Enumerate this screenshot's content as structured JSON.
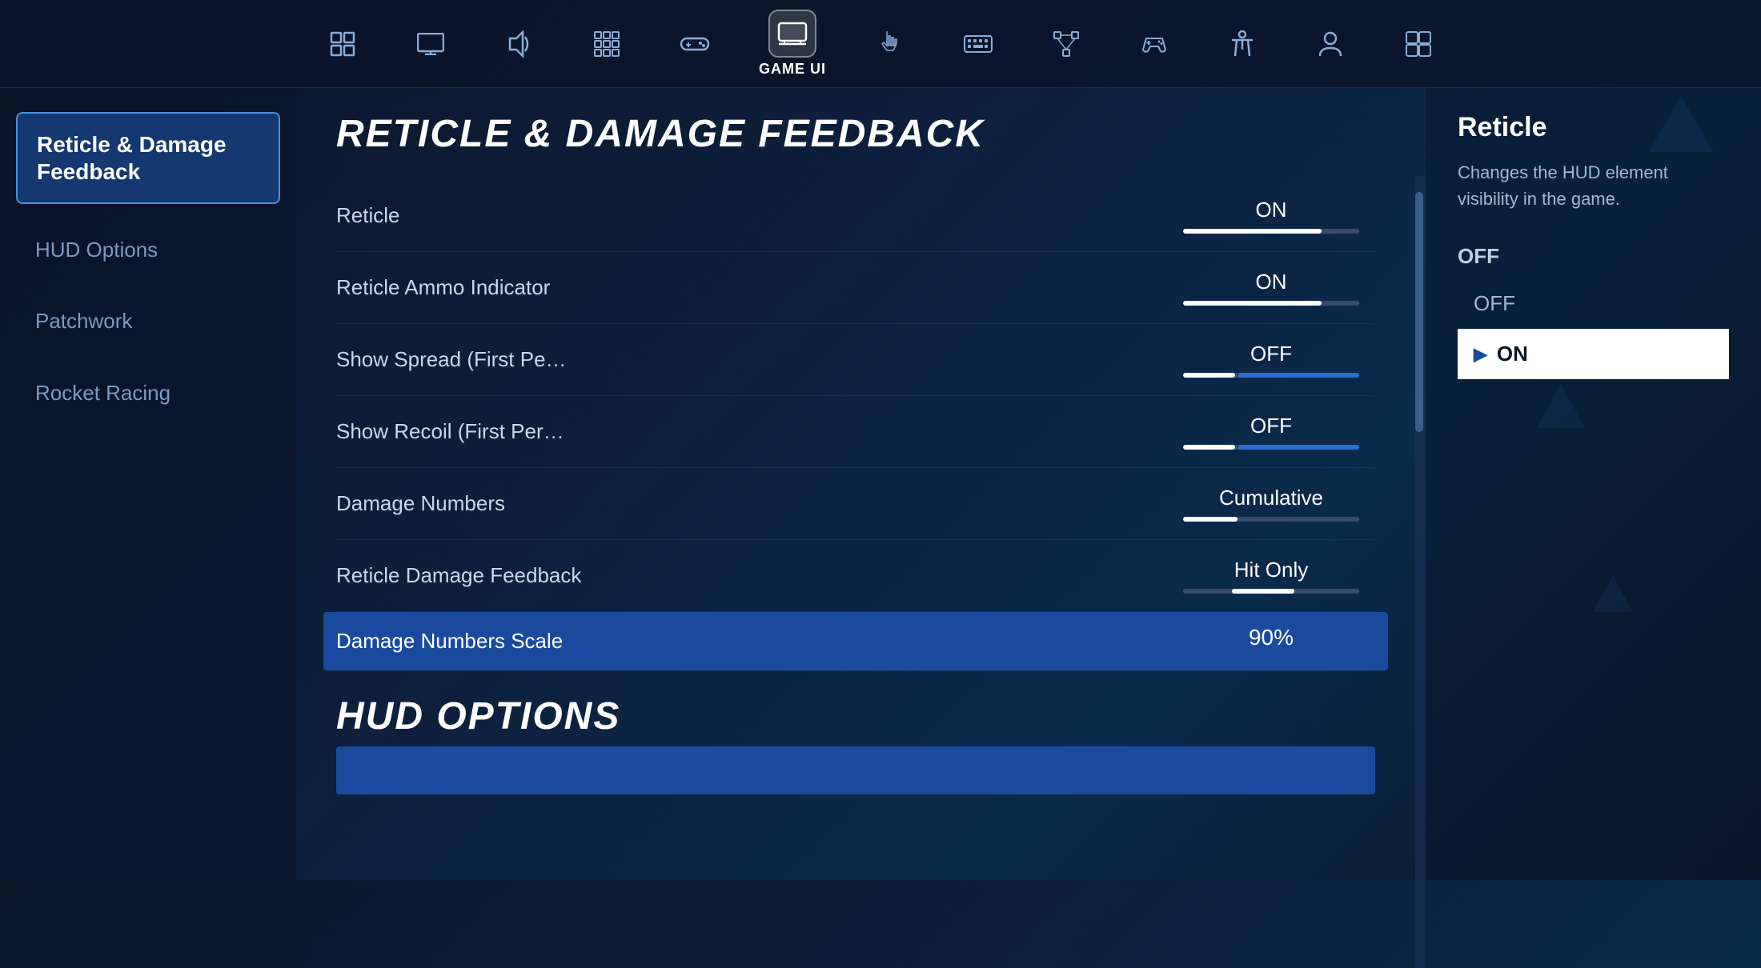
{
  "topNav": {
    "items": [
      {
        "id": "hud",
        "icon": "⬛",
        "label": "",
        "active": false
      },
      {
        "id": "display",
        "icon": "🖥",
        "label": "",
        "active": false
      },
      {
        "id": "audio",
        "icon": "🔊",
        "label": "",
        "active": false
      },
      {
        "id": "controller-layout",
        "icon": "⊞",
        "label": "",
        "active": false
      },
      {
        "id": "controller",
        "icon": "🎮",
        "label": "",
        "active": false
      },
      {
        "id": "game-ui",
        "icon": "🗖",
        "label": "GAME UI",
        "active": true
      },
      {
        "id": "touch",
        "icon": "✋",
        "label": "",
        "active": false
      },
      {
        "id": "keyboard",
        "icon": "⌨",
        "label": "",
        "active": false
      },
      {
        "id": "network",
        "icon": "⧫",
        "label": "",
        "active": false
      },
      {
        "id": "controller2",
        "icon": "🕹",
        "label": "",
        "active": false
      },
      {
        "id": "cross",
        "icon": "✦",
        "label": "",
        "active": false
      },
      {
        "id": "profile",
        "icon": "👤",
        "label": "",
        "active": false
      },
      {
        "id": "menu",
        "icon": "⬡",
        "label": "",
        "active": false
      }
    ]
  },
  "sidebar": {
    "items": [
      {
        "id": "reticle-damage",
        "label": "Reticle & Damage\nFeedback",
        "active": true
      },
      {
        "id": "hud-options",
        "label": "HUD Options",
        "active": false
      },
      {
        "id": "patchwork",
        "label": "Patchwork",
        "active": false
      },
      {
        "id": "rocket-racing",
        "label": "Rocket Racing",
        "active": false
      }
    ]
  },
  "mainContent": {
    "sectionTitle": "RETICLE & DAMAGE FEEDBACK",
    "settings": [
      {
        "id": "reticle",
        "name": "Reticle",
        "value": "ON",
        "sliderType": "on",
        "fillPercent": 80
      },
      {
        "id": "reticle-ammo",
        "name": "Reticle Ammo Indicator",
        "value": "ON",
        "sliderType": "on",
        "fillPercent": 80
      },
      {
        "id": "show-spread",
        "name": "Show Spread (First Pe…",
        "value": "OFF",
        "sliderType": "off",
        "fillPercent": 30
      },
      {
        "id": "show-recoil",
        "name": "Show Recoil (First Per…",
        "value": "OFF",
        "sliderType": "off",
        "fillPercent": 30
      },
      {
        "id": "damage-numbers",
        "name": "Damage Numbers",
        "value": "Cumulative",
        "sliderType": "cumulative"
      },
      {
        "id": "reticle-damage-feedback",
        "name": "Reticle Damage Feedback",
        "value": "Hit Only",
        "sliderType": "hit-only"
      },
      {
        "id": "damage-numbers-scale",
        "name": "Damage Numbers Scale",
        "value": "90%",
        "sliderType": "scale"
      }
    ],
    "hudSectionTitle": "HUD OPTIONS"
  },
  "rightPanel": {
    "title": "Reticle",
    "description": "Changes the HUD element visibility in the game.",
    "optionListLabel": "OFF",
    "options": [
      {
        "id": "off",
        "label": "OFF",
        "selected": false
      },
      {
        "id": "on",
        "label": "ON",
        "selected": true
      }
    ]
  }
}
